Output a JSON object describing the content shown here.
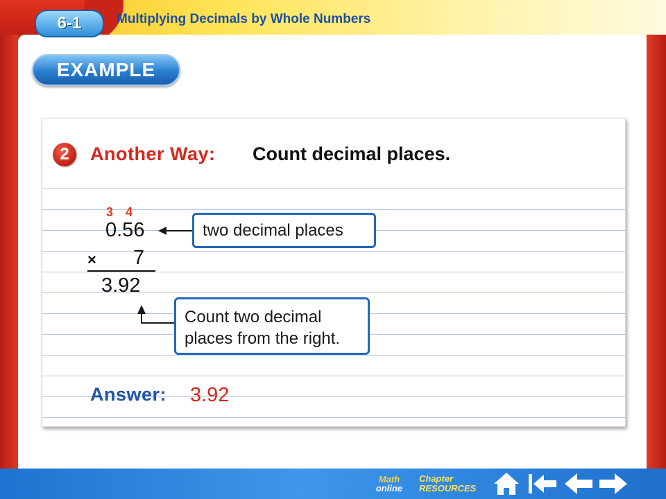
{
  "header": {
    "lesson_number": "6-1",
    "lesson_title": "Multiplying Decimals by Whole Numbers",
    "example_label": "EXAMPLE"
  },
  "example": {
    "step_number": "2",
    "method_label": "Another Way:",
    "heading": "Count decimal places.",
    "carries": [
      "3",
      "4"
    ],
    "multiplicand": "0.56",
    "operator": "×",
    "multiplier": "7",
    "product": "3.92",
    "callout_top": "two decimal places",
    "callout_bottom_line1": "Count two decimal",
    "callout_bottom_line2": "places from the right.",
    "answer_label": "Answer:",
    "answer_value": "3.92"
  },
  "nav": {
    "math_line1": "Math",
    "math_line2": "online",
    "chapter_line1": "Chapter",
    "chapter_line2": "RESOURCES",
    "icons": [
      "home-icon",
      "first-slide-icon",
      "back-arrow-icon",
      "forward-arrow-icon"
    ]
  },
  "colors": {
    "accent_red": "#d8261c",
    "accent_blue": "#1e55a8",
    "callout_border": "#2568b8"
  }
}
